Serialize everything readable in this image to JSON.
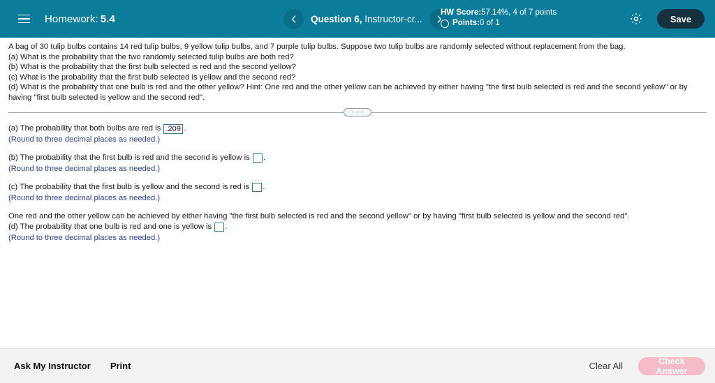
{
  "header": {
    "menu_icon": "hamburger-icon",
    "title_label": "Homework:",
    "title_value": "5.4",
    "prev_icon": "chevron-left-icon",
    "next_icon": "chevron-right-icon",
    "question_label_bold": "Question 6,",
    "question_label_rest": " Instructor-cr...",
    "hw_score_label": "HW Score:",
    "hw_score_value": " 57.14%, 4 of 7 points",
    "points_label": "Points:",
    "points_value": " 0 of 1",
    "settings_icon": "gear-icon",
    "save_label": "Save",
    "bg_color": "#0b7d9b",
    "save_bg_color": "#15313f"
  },
  "question": {
    "intro": "A bag of 30 tulip bulbs contains 14 red tulip bulbs, 9 yellow tulip bulbs, and 7 purple tulip bulbs. Suppose two tulip bulbs are randomly selected without replacement from the bag.",
    "part_a": "(a) What is the probability that the two randomly selected tulip bulbs are both red?",
    "part_b": "(b) What is the probability that the first bulb selected is red and the second yellow?",
    "part_c": "(c) What is the probability that the first bulb selected is yellow and the second red?",
    "part_d": "(d) What is the probability that one bulb is red and the other yellow?  Hint:  One red and the other yellow can be achieved by either having \"the first bulb selected is red and the second yellow\" or by having \"first bulb selected is yellow and the second red\"."
  },
  "divider": {
    "handle_icon": "drag-handle-icon"
  },
  "answers": {
    "round_note": "(Round to three decimal places as needed.)",
    "hint_line": "One red and the other yellow can be achieved by either having \"the first bulb selected is red and the second yellow\" or by having \"first bulb selected is yellow and the second red\".",
    "items": [
      {
        "prompt": "(a) The probability that both bulbs are red is ",
        "value": ".209",
        "suffix": ".",
        "filled": true
      },
      {
        "prompt": "(b) The probability that the first bulb is red and the second is yellow is ",
        "value": "",
        "suffix": ".",
        "filled": false
      },
      {
        "prompt": "(c) The probability that the first bulb is yellow and the second is red is ",
        "value": "",
        "suffix": ".",
        "filled": false
      },
      {
        "prompt": "(d) The probability that one bulb is red and one is yellow is ",
        "value": "",
        "suffix": ".",
        "filled": false
      }
    ]
  },
  "footer": {
    "ask_instructor_label": "Ask My Instructor",
    "print_label": "Print",
    "clear_all_label": "Clear All",
    "check_answer_label": "Check Answer",
    "check_answer_color": "#f5bcc8"
  }
}
